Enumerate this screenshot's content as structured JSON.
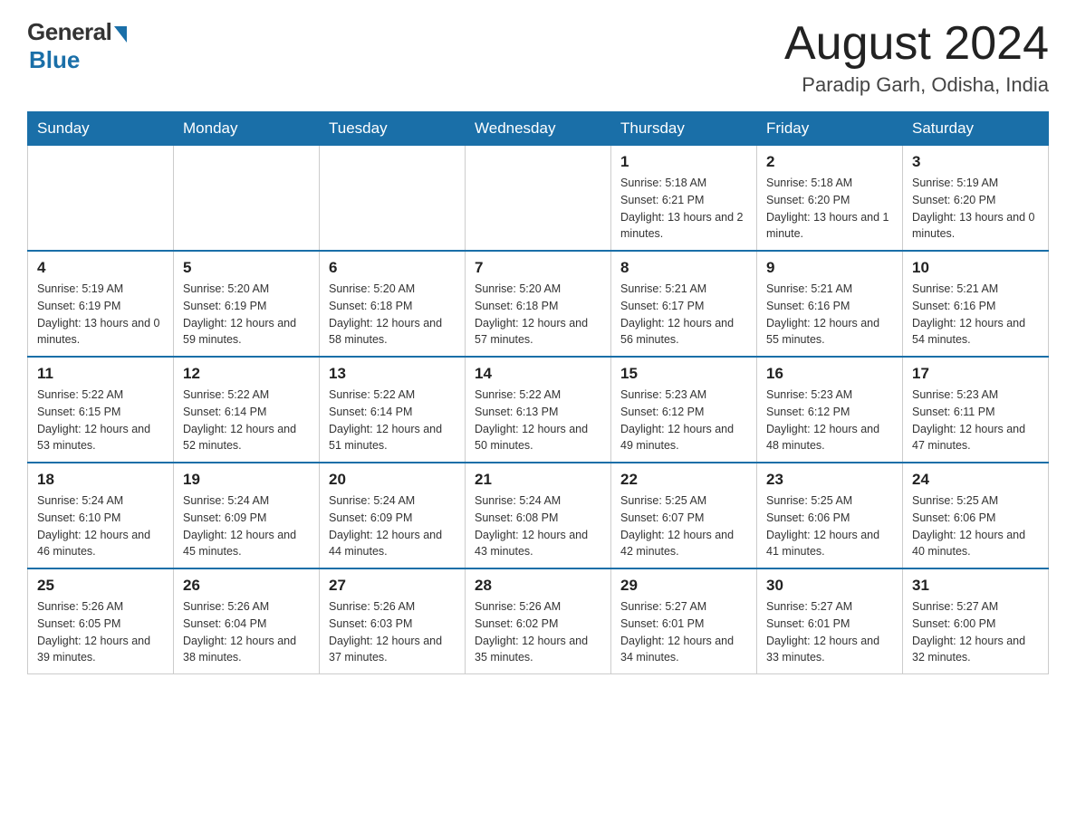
{
  "logo": {
    "general": "General",
    "blue": "Blue"
  },
  "title": {
    "month": "August 2024",
    "location": "Paradip Garh, Odisha, India"
  },
  "weekdays": [
    "Sunday",
    "Monday",
    "Tuesday",
    "Wednesday",
    "Thursday",
    "Friday",
    "Saturday"
  ],
  "weeks": [
    [
      {
        "day": "",
        "sunrise": "",
        "sunset": "",
        "daylight": ""
      },
      {
        "day": "",
        "sunrise": "",
        "sunset": "",
        "daylight": ""
      },
      {
        "day": "",
        "sunrise": "",
        "sunset": "",
        "daylight": ""
      },
      {
        "day": "",
        "sunrise": "",
        "sunset": "",
        "daylight": ""
      },
      {
        "day": "1",
        "sunrise": "Sunrise: 5:18 AM",
        "sunset": "Sunset: 6:21 PM",
        "daylight": "Daylight: 13 hours and 2 minutes."
      },
      {
        "day": "2",
        "sunrise": "Sunrise: 5:18 AM",
        "sunset": "Sunset: 6:20 PM",
        "daylight": "Daylight: 13 hours and 1 minute."
      },
      {
        "day": "3",
        "sunrise": "Sunrise: 5:19 AM",
        "sunset": "Sunset: 6:20 PM",
        "daylight": "Daylight: 13 hours and 0 minutes."
      }
    ],
    [
      {
        "day": "4",
        "sunrise": "Sunrise: 5:19 AM",
        "sunset": "Sunset: 6:19 PM",
        "daylight": "Daylight: 13 hours and 0 minutes."
      },
      {
        "day": "5",
        "sunrise": "Sunrise: 5:20 AM",
        "sunset": "Sunset: 6:19 PM",
        "daylight": "Daylight: 12 hours and 59 minutes."
      },
      {
        "day": "6",
        "sunrise": "Sunrise: 5:20 AM",
        "sunset": "Sunset: 6:18 PM",
        "daylight": "Daylight: 12 hours and 58 minutes."
      },
      {
        "day": "7",
        "sunrise": "Sunrise: 5:20 AM",
        "sunset": "Sunset: 6:18 PM",
        "daylight": "Daylight: 12 hours and 57 minutes."
      },
      {
        "day": "8",
        "sunrise": "Sunrise: 5:21 AM",
        "sunset": "Sunset: 6:17 PM",
        "daylight": "Daylight: 12 hours and 56 minutes."
      },
      {
        "day": "9",
        "sunrise": "Sunrise: 5:21 AM",
        "sunset": "Sunset: 6:16 PM",
        "daylight": "Daylight: 12 hours and 55 minutes."
      },
      {
        "day": "10",
        "sunrise": "Sunrise: 5:21 AM",
        "sunset": "Sunset: 6:16 PM",
        "daylight": "Daylight: 12 hours and 54 minutes."
      }
    ],
    [
      {
        "day": "11",
        "sunrise": "Sunrise: 5:22 AM",
        "sunset": "Sunset: 6:15 PM",
        "daylight": "Daylight: 12 hours and 53 minutes."
      },
      {
        "day": "12",
        "sunrise": "Sunrise: 5:22 AM",
        "sunset": "Sunset: 6:14 PM",
        "daylight": "Daylight: 12 hours and 52 minutes."
      },
      {
        "day": "13",
        "sunrise": "Sunrise: 5:22 AM",
        "sunset": "Sunset: 6:14 PM",
        "daylight": "Daylight: 12 hours and 51 minutes."
      },
      {
        "day": "14",
        "sunrise": "Sunrise: 5:22 AM",
        "sunset": "Sunset: 6:13 PM",
        "daylight": "Daylight: 12 hours and 50 minutes."
      },
      {
        "day": "15",
        "sunrise": "Sunrise: 5:23 AM",
        "sunset": "Sunset: 6:12 PM",
        "daylight": "Daylight: 12 hours and 49 minutes."
      },
      {
        "day": "16",
        "sunrise": "Sunrise: 5:23 AM",
        "sunset": "Sunset: 6:12 PM",
        "daylight": "Daylight: 12 hours and 48 minutes."
      },
      {
        "day": "17",
        "sunrise": "Sunrise: 5:23 AM",
        "sunset": "Sunset: 6:11 PM",
        "daylight": "Daylight: 12 hours and 47 minutes."
      }
    ],
    [
      {
        "day": "18",
        "sunrise": "Sunrise: 5:24 AM",
        "sunset": "Sunset: 6:10 PM",
        "daylight": "Daylight: 12 hours and 46 minutes."
      },
      {
        "day": "19",
        "sunrise": "Sunrise: 5:24 AM",
        "sunset": "Sunset: 6:09 PM",
        "daylight": "Daylight: 12 hours and 45 minutes."
      },
      {
        "day": "20",
        "sunrise": "Sunrise: 5:24 AM",
        "sunset": "Sunset: 6:09 PM",
        "daylight": "Daylight: 12 hours and 44 minutes."
      },
      {
        "day": "21",
        "sunrise": "Sunrise: 5:24 AM",
        "sunset": "Sunset: 6:08 PM",
        "daylight": "Daylight: 12 hours and 43 minutes."
      },
      {
        "day": "22",
        "sunrise": "Sunrise: 5:25 AM",
        "sunset": "Sunset: 6:07 PM",
        "daylight": "Daylight: 12 hours and 42 minutes."
      },
      {
        "day": "23",
        "sunrise": "Sunrise: 5:25 AM",
        "sunset": "Sunset: 6:06 PM",
        "daylight": "Daylight: 12 hours and 41 minutes."
      },
      {
        "day": "24",
        "sunrise": "Sunrise: 5:25 AM",
        "sunset": "Sunset: 6:06 PM",
        "daylight": "Daylight: 12 hours and 40 minutes."
      }
    ],
    [
      {
        "day": "25",
        "sunrise": "Sunrise: 5:26 AM",
        "sunset": "Sunset: 6:05 PM",
        "daylight": "Daylight: 12 hours and 39 minutes."
      },
      {
        "day": "26",
        "sunrise": "Sunrise: 5:26 AM",
        "sunset": "Sunset: 6:04 PM",
        "daylight": "Daylight: 12 hours and 38 minutes."
      },
      {
        "day": "27",
        "sunrise": "Sunrise: 5:26 AM",
        "sunset": "Sunset: 6:03 PM",
        "daylight": "Daylight: 12 hours and 37 minutes."
      },
      {
        "day": "28",
        "sunrise": "Sunrise: 5:26 AM",
        "sunset": "Sunset: 6:02 PM",
        "daylight": "Daylight: 12 hours and 35 minutes."
      },
      {
        "day": "29",
        "sunrise": "Sunrise: 5:27 AM",
        "sunset": "Sunset: 6:01 PM",
        "daylight": "Daylight: 12 hours and 34 minutes."
      },
      {
        "day": "30",
        "sunrise": "Sunrise: 5:27 AM",
        "sunset": "Sunset: 6:01 PM",
        "daylight": "Daylight: 12 hours and 33 minutes."
      },
      {
        "day": "31",
        "sunrise": "Sunrise: 5:27 AM",
        "sunset": "Sunset: 6:00 PM",
        "daylight": "Daylight: 12 hours and 32 minutes."
      }
    ]
  ]
}
